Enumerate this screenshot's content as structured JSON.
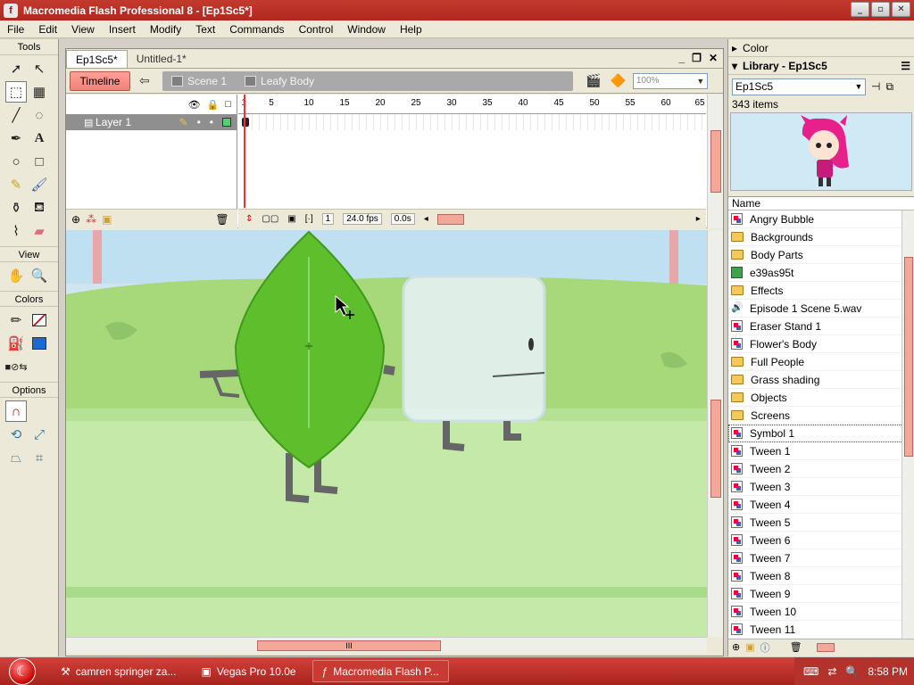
{
  "window": {
    "title": "Macromedia Flash Professional 8 - [Ep1Sc5*]"
  },
  "menu": [
    "File",
    "Edit",
    "View",
    "Insert",
    "Modify",
    "Text",
    "Commands",
    "Control",
    "Window",
    "Help"
  ],
  "tools": {
    "title": "Tools",
    "view_label": "View",
    "colors_label": "Colors",
    "options_label": "Options"
  },
  "document": {
    "tabs": [
      "Ep1Sc5*",
      "Untitled-1*"
    ],
    "timeline_button": "Timeline",
    "breadcrumbs": [
      "Scene 1",
      "Leafy Body"
    ],
    "zoom": "100%"
  },
  "timeline": {
    "layer_name": "Layer 1",
    "ruler_ticks": [
      "1",
      "5",
      "10",
      "15",
      "20",
      "25",
      "30",
      "35",
      "40",
      "45",
      "50",
      "55",
      "60",
      "65"
    ],
    "current_frame": "1",
    "frame_rate": "24.0 fps",
    "elapsed_time": "0.0s"
  },
  "right_panel": {
    "color_title": "Color",
    "library_title": "Library - Ep1Sc5",
    "library_select": "Ep1Sc5",
    "item_count": "343 items",
    "column_name": "Name",
    "items": [
      {
        "name": "Angry Bubble",
        "icon": "symbol"
      },
      {
        "name": "Backgrounds",
        "icon": "folder"
      },
      {
        "name": "Body Parts",
        "icon": "folder"
      },
      {
        "name": "e39as95t",
        "icon": "bitmap"
      },
      {
        "name": "Effects",
        "icon": "folder"
      },
      {
        "name": "Episode 1 Scene 5.wav",
        "icon": "sound"
      },
      {
        "name": "Eraser Stand 1",
        "icon": "symbol"
      },
      {
        "name": "Flower's Body",
        "icon": "symbol"
      },
      {
        "name": "Full People",
        "icon": "folder"
      },
      {
        "name": "Grass shading",
        "icon": "folder"
      },
      {
        "name": "Objects",
        "icon": "folder"
      },
      {
        "name": "Screens",
        "icon": "folder"
      },
      {
        "name": "Symbol 1",
        "icon": "symbol",
        "selected": true
      },
      {
        "name": "Tween 1",
        "icon": "symbol"
      },
      {
        "name": "Tween 2",
        "icon": "symbol"
      },
      {
        "name": "Tween 3",
        "icon": "symbol"
      },
      {
        "name": "Tween 4",
        "icon": "symbol"
      },
      {
        "name": "Tween 5",
        "icon": "symbol"
      },
      {
        "name": "Tween 6",
        "icon": "symbol"
      },
      {
        "name": "Tween 7",
        "icon": "symbol"
      },
      {
        "name": "Tween 8",
        "icon": "symbol"
      },
      {
        "name": "Tween 9",
        "icon": "symbol"
      },
      {
        "name": "Tween 10",
        "icon": "symbol"
      },
      {
        "name": "Tween 11",
        "icon": "symbol"
      }
    ]
  },
  "taskbar": {
    "tasks": [
      "camren springer za...",
      "Vegas Pro 10.0e",
      "Macromedia Flash P..."
    ],
    "clock": "8:58 PM"
  },
  "colors": {
    "titlebar": "#b72a22",
    "leaf": "#5fbe2b",
    "timeline_btn": "#f48b80"
  }
}
